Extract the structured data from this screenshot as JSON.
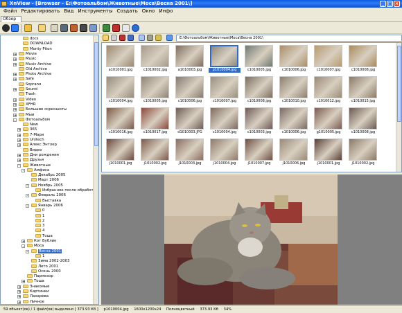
{
  "window": {
    "title": "XnView - [Browser - E:\\Фотоальбом\\Животные\\Моса\\Весна 2001\\]"
  },
  "menu": [
    "Файл",
    "Редактировать",
    "Вид",
    "Инструменты",
    "Создать",
    "Окно",
    "Инфо"
  ],
  "tab": {
    "label": "Обзор"
  },
  "path": "E:\\Фотоальбом\\Животные\\Моса\\Весна 2001\\",
  "tree": [
    {
      "label": "docs",
      "depth": 4,
      "expander": ""
    },
    {
      "label": "DOWNLOAD",
      "depth": 4,
      "expander": ""
    },
    {
      "label": "Monty Piton",
      "depth": 4,
      "expander": ""
    },
    {
      "label": "Movie",
      "depth": 3,
      "expander": "+"
    },
    {
      "label": "Music",
      "depth": 3,
      "expander": "+"
    },
    {
      "label": "Music Archive",
      "depth": 3,
      "expander": "+"
    },
    {
      "label": "Old Archive",
      "depth": 3,
      "expander": ""
    },
    {
      "label": "Photo Archive",
      "depth": 3,
      "expander": "+"
    },
    {
      "label": "Safe",
      "depth": 3,
      "expander": "+"
    },
    {
      "label": "Soprano",
      "depth": 3,
      "expander": ""
    },
    {
      "label": "Sound",
      "depth": 3,
      "expander": "+"
    },
    {
      "label": "Trash",
      "depth": 3,
      "expander": ""
    },
    {
      "label": "Video",
      "depth": 3,
      "expander": "+"
    },
    {
      "label": "XFHR",
      "depth": 3,
      "expander": "+"
    },
    {
      "label": "Большие скриншоты",
      "depth": 3,
      "expander": "+"
    },
    {
      "label": "Мыи",
      "depth": 3,
      "expander": "+"
    },
    {
      "label": "Фотоальбом",
      "depth": 3,
      "expander": "-"
    },
    {
      "label": "New",
      "depth": 4,
      "expander": ""
    },
    {
      "label": "365",
      "depth": 4,
      "expander": "+"
    },
    {
      "label": "7-Мари",
      "depth": 4,
      "expander": "+"
    },
    {
      "label": "Unitech",
      "depth": 4,
      "expander": "+"
    },
    {
      "label": "Алекс Энтлер",
      "depth": 4,
      "expander": "+"
    },
    {
      "label": "Видео",
      "depth": 4,
      "expander": ""
    },
    {
      "label": "Дни рождения",
      "depth": 4,
      "expander": "+"
    },
    {
      "label": "Друзья",
      "depth": 4,
      "expander": "+"
    },
    {
      "label": "Животные",
      "depth": 4,
      "expander": "-"
    },
    {
      "label": "Амфиса",
      "depth": 5,
      "expander": "-"
    },
    {
      "label": "Декабрь 2005",
      "depth": 6,
      "expander": ""
    },
    {
      "label": "Март 2006",
      "depth": 6,
      "expander": ""
    },
    {
      "label": "Ноябрь 2005",
      "depth": 6,
      "expander": "-"
    },
    {
      "label": "Избранное после обработ",
      "depth": 7,
      "expander": ""
    },
    {
      "label": "Февраль 2006",
      "depth": 6,
      "expander": "-"
    },
    {
      "label": "Выставка",
      "depth": 7,
      "expander": ""
    },
    {
      "label": "Январь 2006",
      "depth": 6,
      "expander": "-"
    },
    {
      "label": "0",
      "depth": 7,
      "expander": ""
    },
    {
      "label": "1",
      "depth": 7,
      "expander": ""
    },
    {
      "label": "2",
      "depth": 7,
      "expander": ""
    },
    {
      "label": "3",
      "depth": 7,
      "expander": ""
    },
    {
      "label": "4",
      "depth": 7,
      "expander": ""
    },
    {
      "label": "Тоша",
      "depth": 7,
      "expander": ""
    },
    {
      "label": "Кот Бублик",
      "depth": 5,
      "expander": "+"
    },
    {
      "label": "Моса",
      "depth": 5,
      "expander": "-"
    },
    {
      "label": "Весна 2001",
      "depth": 6,
      "expander": "-",
      "selected": true
    },
    {
      "label": "1",
      "depth": 7,
      "expander": ""
    },
    {
      "label": "Зима 2002-2003",
      "depth": 6,
      "expander": ""
    },
    {
      "label": "Лето 2001",
      "depth": 6,
      "expander": ""
    },
    {
      "label": "Осень 2000",
      "depth": 6,
      "expander": ""
    },
    {
      "label": "Пармезор",
      "depth": 5,
      "expander": ""
    },
    {
      "label": "Тоша",
      "depth": 5,
      "expander": "+"
    },
    {
      "label": "Знакомые",
      "depth": 4,
      "expander": "+"
    },
    {
      "label": "Картинки",
      "depth": 4,
      "expander": "+"
    },
    {
      "label": "Лахарева",
      "depth": 4,
      "expander": "+"
    },
    {
      "label": "Личное",
      "depth": 4,
      "expander": "+"
    }
  ],
  "thumbnails": [
    {
      "label": "a1010001.jpg",
      "color": "#9b8870"
    },
    {
      "label": "c1010002.jpg",
      "color": "#a6998c"
    },
    {
      "label": "a1010003.jpg",
      "color": "#7f6d5e"
    },
    {
      "label": "p1010004.jpg",
      "color": "#8e8a80",
      "selected": true
    },
    {
      "label": "c1010005.jpg",
      "color": "#6f7a72"
    },
    {
      "label": "c1010006.jpg",
      "color": "#a98e68"
    },
    {
      "label": "c1010007.jpg",
      "color": "#b59a70"
    },
    {
      "label": "c1010008.jpg",
      "color": "#a88b5f"
    },
    {
      "label": "c1010004.jpg",
      "color": "#968b7d"
    },
    {
      "label": "c1010005.jpg",
      "color": "#8e8478"
    },
    {
      "label": "c1010006.jpg",
      "color": "#857a6f"
    },
    {
      "label": "c1010007.jpg",
      "color": "#9a8f80"
    },
    {
      "label": "c1010008.jpg",
      "color": "#7c6e62"
    },
    {
      "label": "c1010010.jpg",
      "color": "#8d7f70"
    },
    {
      "label": "c1010012.jpg",
      "color": "#9a8a76"
    },
    {
      "label": "c1010015.jpg",
      "color": "#8b7a68"
    },
    {
      "label": "c1010016.jpg",
      "color": "#7a5a48"
    },
    {
      "label": "c1010017.jpg",
      "color": "#8a4a3c"
    },
    {
      "label": "d1010003.JPG",
      "color": "#6e5c55"
    },
    {
      "label": "c1010004.jpg",
      "color": "#7e6a60"
    },
    {
      "label": "c1010003.jpg",
      "color": "#6f5a58"
    },
    {
      "label": "c1010006.jpg",
      "color": "#7b6a63"
    },
    {
      "label": "g1010005.jpg",
      "color": "#7a5b50"
    },
    {
      "label": "c1010008.jpg",
      "color": "#6a5a52"
    },
    {
      "label": "j1010001.jpg",
      "color": "#6a4a3e"
    },
    {
      "label": "j1010002.jpg",
      "color": "#7b5a4c"
    },
    {
      "label": "j1010003.jpg",
      "color": "#8a6e62"
    },
    {
      "label": "j1010004.jpg",
      "color": "#8e7a6a"
    },
    {
      "label": "j1010007.jpg",
      "color": "#6e5044"
    },
    {
      "label": "j1010006.jpg",
      "color": "#9a8a78"
    },
    {
      "label": "j1010001.jpg",
      "color": "#5a4038"
    },
    {
      "label": "j1010002.jpg",
      "color": "#8a7a68"
    }
  ],
  "status": {
    "objects": "59 объект(ов) / 1 файл(ов) выделено  [ 373.93 Кб ]",
    "file": "p1010004.jpg",
    "dims": "1600x1200x24",
    "mode": "Полноцветный",
    "size": "373.93 Кб",
    "zoom": "34%"
  }
}
